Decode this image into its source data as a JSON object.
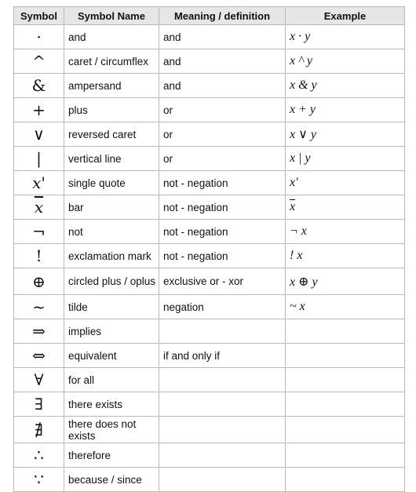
{
  "headers": [
    "Symbol",
    "Symbol Name",
    "Meaning / definition",
    "Example"
  ],
  "rows": [
    {
      "symbol": "·",
      "name": "and",
      "meaning": "and",
      "example": "x · y"
    },
    {
      "symbol": "^",
      "name": "caret / circumflex",
      "meaning": "and",
      "example": "x ^ y"
    },
    {
      "symbol": "&",
      "name": "ampersand",
      "meaning": "and",
      "example": "x & y"
    },
    {
      "symbol": "+",
      "name": "plus",
      "meaning": "or",
      "example": "x + y"
    },
    {
      "symbol": "∨",
      "name": "reversed caret",
      "meaning": "or",
      "example": "x ∨ y"
    },
    {
      "symbol": "|",
      "name": "vertical line",
      "meaning": "or",
      "example": "x | y"
    },
    {
      "symbol": "x'",
      "name": "single quote",
      "meaning": "not - negation",
      "example": "x'"
    },
    {
      "symbol": "x",
      "name": "bar",
      "meaning": "not - negation",
      "example": "x"
    },
    {
      "symbol": "¬",
      "name": "not",
      "meaning": "not - negation",
      "example": "¬ x"
    },
    {
      "symbol": "!",
      "name": "exclamation mark",
      "meaning": "not - negation",
      "example": "! x"
    },
    {
      "symbol": "⊕",
      "name": "circled plus / oplus",
      "meaning": "exclusive or - xor",
      "example": "x ⊕ y"
    },
    {
      "symbol": "~",
      "name": "tilde",
      "meaning": "negation",
      "example": "~ x"
    },
    {
      "symbol": "⇒",
      "name": "implies",
      "meaning": "",
      "example": ""
    },
    {
      "symbol": "⇔",
      "name": "equivalent",
      "meaning": "if and only if",
      "example": ""
    },
    {
      "symbol": "∀",
      "name": "for all",
      "meaning": "",
      "example": ""
    },
    {
      "symbol": "∃",
      "name": "there exists",
      "meaning": "",
      "example": ""
    },
    {
      "symbol": "∄",
      "name": "there does not exists",
      "meaning": "",
      "example": ""
    },
    {
      "symbol": "∴",
      "name": "therefore",
      "meaning": "",
      "example": ""
    },
    {
      "symbol": "∵",
      "name": "because / since",
      "meaning": "",
      "example": ""
    }
  ]
}
